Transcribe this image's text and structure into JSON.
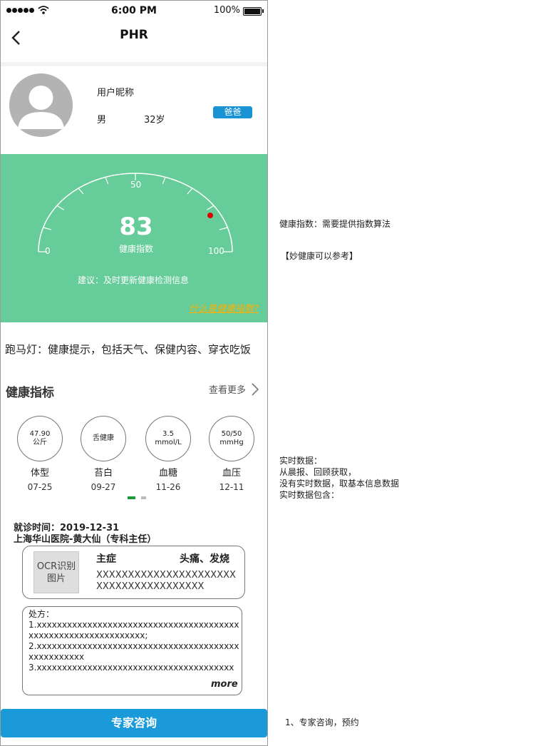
{
  "status_bar": {
    "time": "6:00 PM",
    "battery": "100%"
  },
  "nav": {
    "title": "PHR"
  },
  "profile": {
    "nickname": "用户昵称",
    "gender": "男",
    "age": "32岁",
    "relation": "爸爸"
  },
  "health": {
    "score": "83",
    "score_label": "健康指数",
    "scale_min": "0",
    "scale_mid": "50",
    "scale_max": "100",
    "score_fraction": 0.83,
    "advice": "建议：及时更新健康检测信息",
    "link": "什么是健康指数?"
  },
  "marquee": {
    "text": "跑马灯：健康提示，包括天气、保健内容、穿衣吃饭"
  },
  "indicators": {
    "title": "健康指标",
    "see_more": "查看更多",
    "items": [
      {
        "value_line1": "47.90",
        "value_line2": "公斤",
        "name": "体型",
        "date": "07-25"
      },
      {
        "value_line1": "舌健康",
        "value_line2": "",
        "name": "苔白",
        "date": "09-27"
      },
      {
        "value_line1": "3.5",
        "value_line2": "mmol/L",
        "name": "血糖",
        "date": "11-26"
      },
      {
        "value_line1": "50/50",
        "value_line2": "mmHg",
        "name": "血压",
        "date": "12-11"
      }
    ]
  },
  "visit": {
    "time": "就诊时间：2019-12-31",
    "hospital": "上海华山医院-黄大仙（专科主任）",
    "ocr_label": "OCR识别图片",
    "complaint_label": "主症",
    "complaint_value": "头痛、发烧",
    "complaint_detail": "XXXXXXXXXXXXXXXXXXXXXXXXXXXXXXXXXXXXXXX",
    "rx_title": "处方：",
    "rx_lines": [
      "1.xxxxxxxxxxxxxxxxxxxxxxxxxxxxxxxxxxxxxxxxxxxxxxxxxxxxxxxxxxxxxxx;",
      "2.xxxxxxxxxxxxxxxxxxxxxxxxxxxxxxxxxxxxxxxxxxxxxxxxxxx",
      "3.xxxxxxxxxxxxxxxxxxxxxxxxxxxxxxxxxxxxxxx"
    ],
    "more": "more"
  },
  "cta": {
    "label": "专家咨询"
  },
  "notes": {
    "health_index": "健康指数：需要提供指数算法",
    "reference": "【妙健康可以参考】",
    "realtime_1": "实时数据：",
    "realtime_2": "从晨报、回顾获取，",
    "realtime_3": "没有实时数据，取基本信息数据",
    "realtime_4": "实时数据包含：",
    "consult": "1、专家咨询，预约"
  },
  "colors": {
    "health_bg": "#66cc99",
    "accent_blue": "#1a9ad8",
    "link_orange": "#ffb000",
    "marker_red": "#e00000"
  }
}
